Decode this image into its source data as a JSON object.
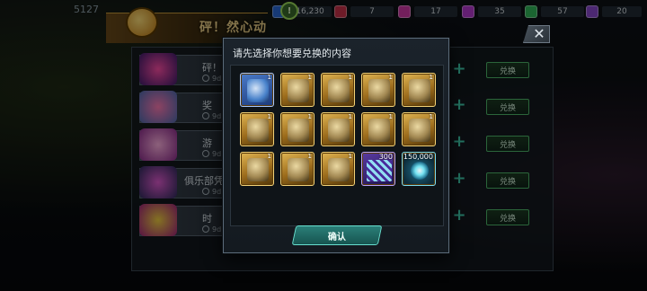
{
  "topbar": {
    "player_num": "5127",
    "currencies": [
      {
        "icon": "coin-icon",
        "value": "16,230",
        "color": "#2a6bd8"
      },
      {
        "icon": "red-gem-icon",
        "value": "7",
        "color": "#c8324a"
      },
      {
        "icon": "pink-gem-icon",
        "value": "17",
        "color": "#d13aa8"
      },
      {
        "icon": "magenta-gem-icon",
        "value": "35",
        "color": "#b63ad0"
      },
      {
        "icon": "green-gem-icon",
        "value": "57",
        "color": "#32b85a"
      },
      {
        "icon": "ticket-icon",
        "value": "20",
        "color": "#8a4ad0"
      }
    ]
  },
  "event": {
    "title": "砰！然心动",
    "timer_badge": "!"
  },
  "list": {
    "rows": [
      {
        "label": "砰！",
        "time": "9d"
      },
      {
        "label": "奖",
        "time": "9d"
      },
      {
        "label": "游",
        "time": "9d"
      },
      {
        "label": "俱乐部凭",
        "time": "9d"
      },
      {
        "label": "时",
        "time": "9d"
      }
    ],
    "exchange_label": "兑换"
  },
  "modal": {
    "title": "请先选择你想要兑换的内容",
    "close": "✕",
    "confirm": "确认",
    "items": [
      {
        "kind": "blue",
        "qty": "1"
      },
      {
        "kind": "gold",
        "qty": "1"
      },
      {
        "kind": "gold",
        "qty": "1"
      },
      {
        "kind": "gold",
        "qty": "1"
      },
      {
        "kind": "gold",
        "qty": "1"
      },
      {
        "kind": "gold",
        "qty": "1"
      },
      {
        "kind": "gold",
        "qty": "1"
      },
      {
        "kind": "gold",
        "qty": "1"
      },
      {
        "kind": "gold",
        "qty": "1"
      },
      {
        "kind": "gold",
        "qty": "1"
      },
      {
        "kind": "gold",
        "qty": "1"
      },
      {
        "kind": "gold",
        "qty": "1"
      },
      {
        "kind": "gold",
        "qty": "1"
      },
      {
        "kind": "purple",
        "qty": "300"
      },
      {
        "kind": "teal",
        "qty": "150,000"
      }
    ]
  }
}
